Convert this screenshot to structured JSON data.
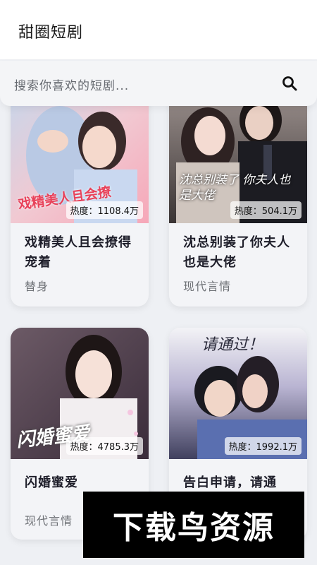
{
  "app": {
    "title": "甜圈短剧"
  },
  "search": {
    "placeholder": "搜索你喜欢的短剧...",
    "icon": "search-icon"
  },
  "dramas": [
    {
      "title": "戏精美人且会撩得宠着",
      "heat": "热度：1108.4万",
      "tag": "替身",
      "poster_text": "戏精美人且会撩"
    },
    {
      "title": "沈总别装了你夫人也是大佬",
      "heat": "热度：504.1万",
      "tag": "现代言情",
      "poster_text": "沈总别装了 你夫人也是大佬"
    },
    {
      "title": "闪婚蜜爱",
      "heat": "热度：4785.3万",
      "tag": "现代言情",
      "poster_text": "闪婚蜜爱"
    },
    {
      "title": "告白申请，请通",
      "heat": "热度：1992.1万",
      "tag": "",
      "poster_text": "请通过！"
    }
  ],
  "watermark": {
    "text": "下载鸟资源"
  },
  "colors": {
    "background": "#eef0f4",
    "card": "#f3f4f7",
    "title": "#1e1e2a",
    "tag": "#6e7176"
  }
}
